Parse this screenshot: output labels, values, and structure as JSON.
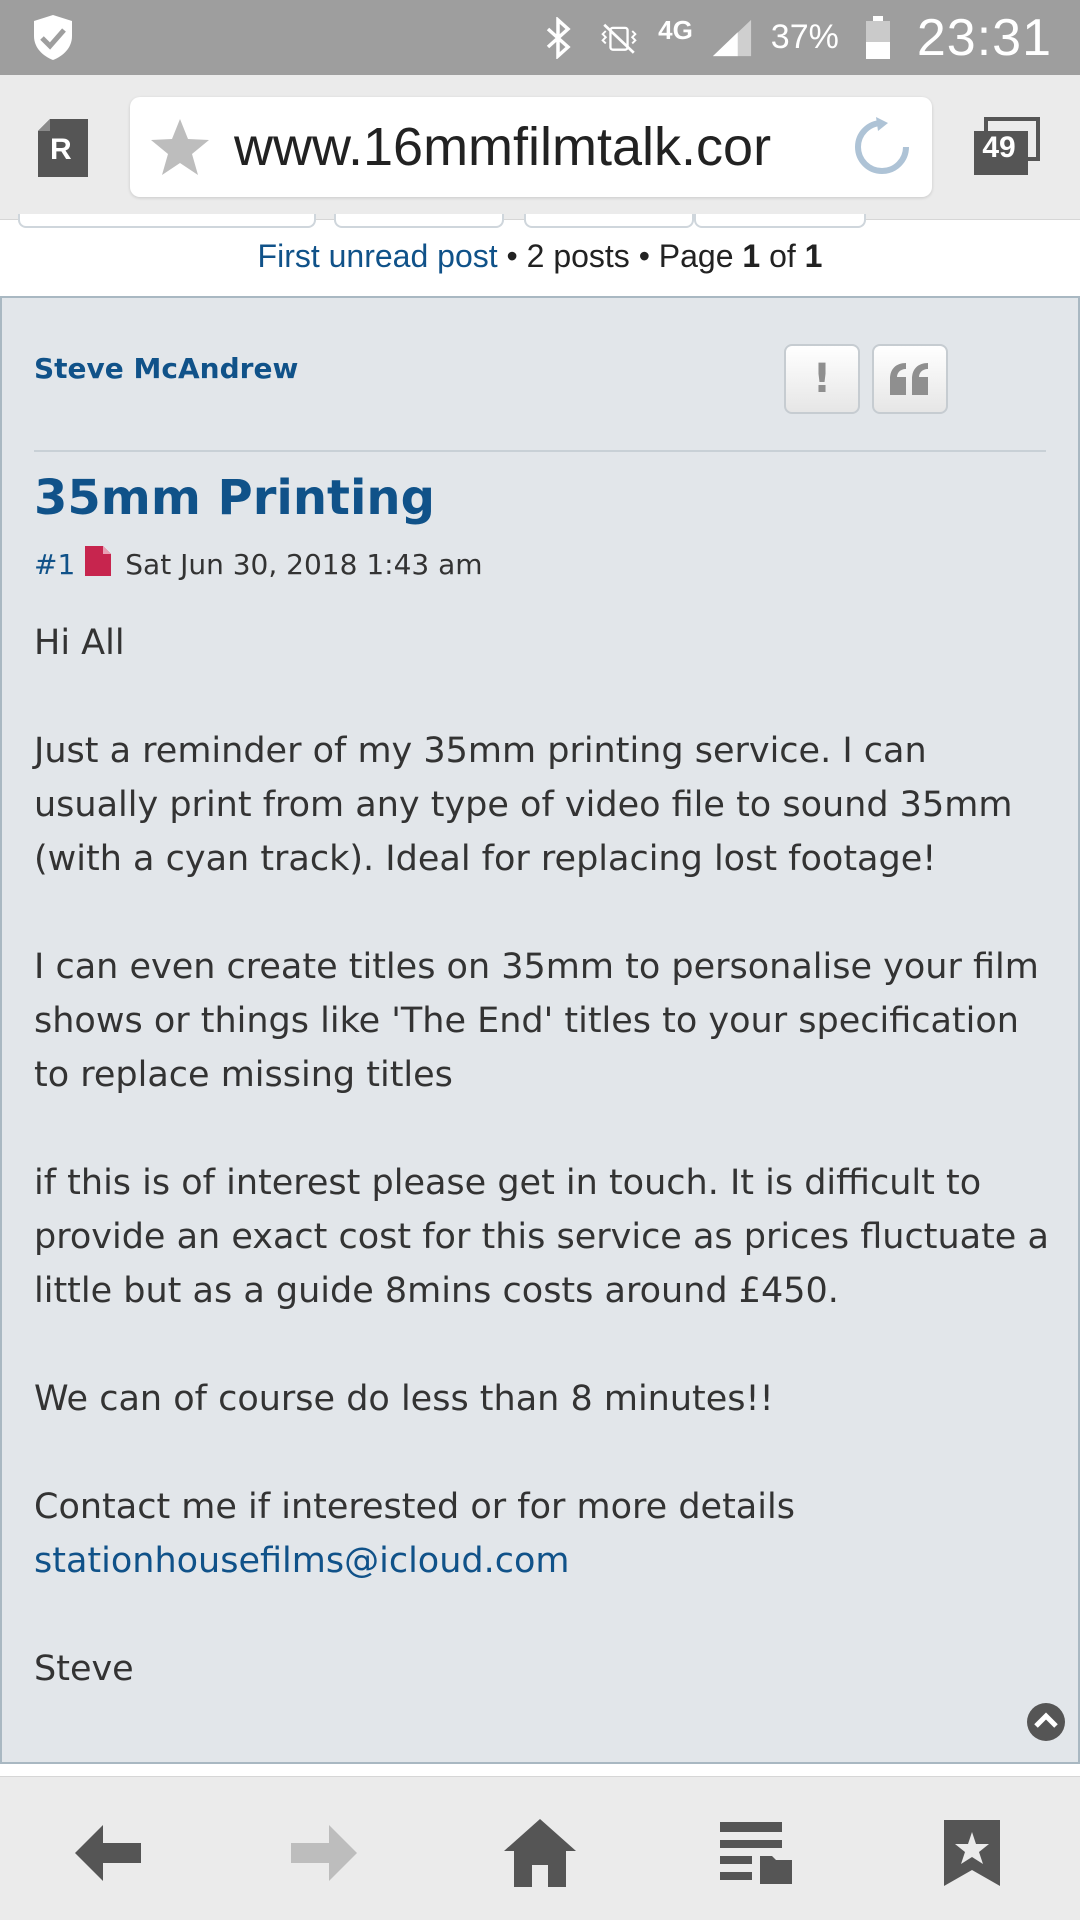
{
  "status_bar": {
    "network": "4G",
    "battery_percent": "37%",
    "time": "23:31",
    "icons": [
      "shield-icon",
      "bluetooth-icon",
      "vibrate-mute-icon",
      "signal-icon",
      "battery-icon"
    ]
  },
  "browser": {
    "reader_label": "R",
    "url": "www.16mmfilmtalk.cor",
    "tab_count": "49"
  },
  "pagination": {
    "first_unread": "First unread post",
    "sep1": " • ",
    "post_count": "2 posts",
    "sep2": " • Page ",
    "page_current": "1",
    "of_text": " of ",
    "page_total": "1"
  },
  "post": {
    "author": "Steve McAndrew",
    "report_label": "!",
    "title": "35mm Printing",
    "number": "#1",
    "date": "Sat Jun 30, 2018 1:43 am",
    "paragraphs": [
      "Hi All",
      "Just a reminder of my 35mm printing service. I can usually print from any type of video file to sound 35mm (with a cyan track). Ideal for replacing lost footage!",
      "I can even create titles on 35mm to personalise your film shows or things like 'The End' titles to your specification to replace missing titles",
      "if this is of interest please get in touch. It is difficult to provide an exact cost for this service as prices fluctuate a little but as a guide 8mins costs around £450.",
      "We can of course do less than 8 minutes!!",
      "Contact me if interested or for more details"
    ],
    "email": "stationhousefilms@icloud.com",
    "signature": "Steve"
  },
  "colors": {
    "link": "#105289",
    "post_bg": "#e2e6ea",
    "status_bar": "#9e9e9e",
    "toolbar": "#ebebeb",
    "doc_icon": "#c7254e"
  }
}
